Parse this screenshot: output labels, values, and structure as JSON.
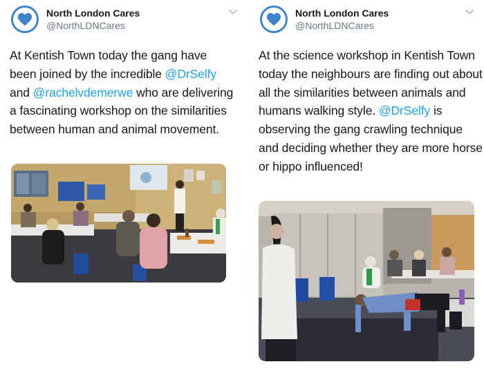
{
  "tweets": [
    {
      "account_name": "North London Cares",
      "handle": "@NorthLDNCares",
      "text_parts": [
        "At Kentish Town today the gang have been joined by the incredible ",
        "@DrSelfy",
        " and ",
        "@rachelvdemerwe",
        " who are delivering a fascinating workshop on the similarities between human and animal movement."
      ]
    },
    {
      "account_name": "North London Cares",
      "handle": "@NorthLDNCares",
      "text_parts": [
        "At the science workshop in Kentish Town today the neighbours are finding out about all the similarities between animals and humans walking style. ",
        "@DrSelfy",
        " is observing the gang crawling technique and deciding whether they are more horse or hippo influenced!"
      ]
    }
  ],
  "colors": {
    "brand_blue": "#3b84c8",
    "mention_blue": "#1da1f2",
    "secondary_text": "#657786"
  },
  "icons": {
    "avatar": "heart-icon",
    "menu": "chevron-down-icon"
  }
}
